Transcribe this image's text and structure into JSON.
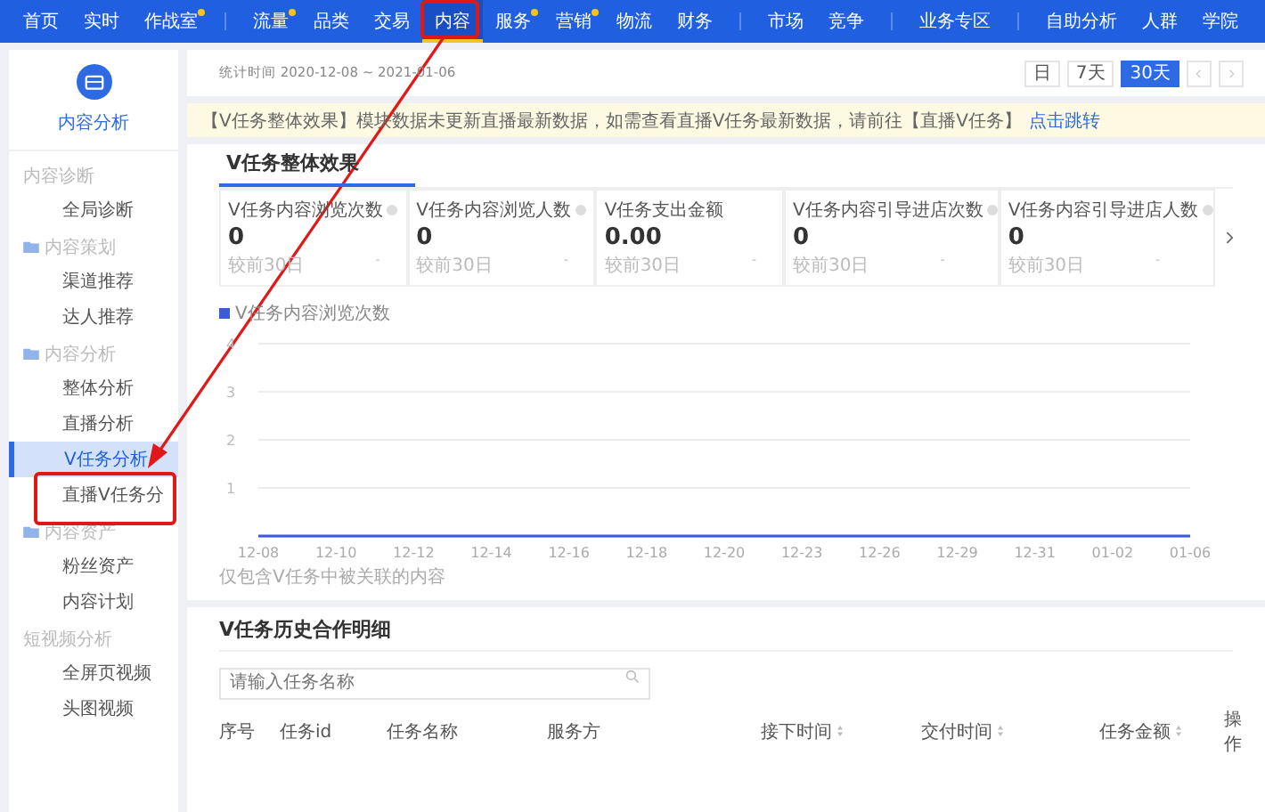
{
  "nav": {
    "groups": [
      {
        "items": [
          {
            "label": "首页",
            "selected": false,
            "dot": false
          },
          {
            "label": "实时",
            "selected": false,
            "dot": false
          },
          {
            "label": "作战室",
            "selected": false,
            "dot": true
          }
        ]
      },
      {
        "items": [
          {
            "label": "流量",
            "selected": false,
            "dot": true
          },
          {
            "label": "品类",
            "selected": false,
            "dot": false
          },
          {
            "label": "交易",
            "selected": false,
            "dot": false
          },
          {
            "label": "内容",
            "selected": true,
            "dot": false
          },
          {
            "label": "服务",
            "selected": false,
            "dot": true
          },
          {
            "label": "营销",
            "selected": false,
            "dot": true
          },
          {
            "label": "物流",
            "selected": false,
            "dot": false
          },
          {
            "label": "财务",
            "selected": false,
            "dot": false
          }
        ]
      },
      {
        "items": [
          {
            "label": "市场",
            "selected": false,
            "dot": false
          },
          {
            "label": "竞争",
            "selected": false,
            "dot": false
          }
        ]
      },
      {
        "items": [
          {
            "label": "业务专区",
            "selected": false,
            "dot": false
          }
        ]
      },
      {
        "items": [
          {
            "label": "自助分析",
            "selected": false,
            "dot": false
          },
          {
            "label": "人群",
            "selected": false,
            "dot": false
          },
          {
            "label": "学院",
            "selected": false,
            "dot": false
          }
        ]
      }
    ]
  },
  "sidebar": {
    "title": "内容分析",
    "items": [
      {
        "kind": "heading",
        "label": "内容诊断"
      },
      {
        "kind": "link",
        "label": "全局诊断",
        "selected": false
      },
      {
        "kind": "folder",
        "label": "内容策划"
      },
      {
        "kind": "link",
        "label": "渠道推荐",
        "selected": false
      },
      {
        "kind": "link",
        "label": "达人推荐",
        "selected": false
      },
      {
        "kind": "folder",
        "label": "内容分析"
      },
      {
        "kind": "link",
        "label": "整体分析",
        "selected": false
      },
      {
        "kind": "link",
        "label": "直播分析",
        "selected": false
      },
      {
        "kind": "link",
        "label": "V任务分析",
        "selected": true
      },
      {
        "kind": "link",
        "label": "直播V任务分",
        "selected": false
      },
      {
        "kind": "folder",
        "label": "内容资产"
      },
      {
        "kind": "link",
        "label": "粉丝资产",
        "selected": false
      },
      {
        "kind": "link",
        "label": "内容计划",
        "selected": false
      },
      {
        "kind": "heading",
        "label": "短视频分析"
      },
      {
        "kind": "link",
        "label": "全屏页视频",
        "selected": false
      },
      {
        "kind": "link",
        "label": "头图视频",
        "selected": false
      }
    ]
  },
  "date_bar": {
    "range": "统计时间 2020-12-08 ~ 2021-01-06",
    "periods": [
      {
        "label": "日",
        "selected": false
      },
      {
        "label": "7天",
        "selected": false
      },
      {
        "label": "30天",
        "selected": true
      }
    ]
  },
  "notice": {
    "text": "【V任务整体效果】模块数据未更新直播最新数据，如需查看直播V任务最新数据，请前往【直播V任务】",
    "link": "点击跳转"
  },
  "overview": {
    "tab": "V任务整体效果",
    "metrics": [
      {
        "label": "V任务内容浏览次数",
        "info": true,
        "value": "0",
        "compare": "较前30日",
        "change": "-"
      },
      {
        "label": "V任务内容浏览人数",
        "info": true,
        "value": "0",
        "compare": "较前30日",
        "change": "-"
      },
      {
        "label": "V任务支出金额",
        "info": false,
        "value": "0.00",
        "compare": "较前30日",
        "change": "-"
      },
      {
        "label": "V任务内容引导进店次数",
        "info": true,
        "value": "0",
        "compare": "较前30日",
        "change": "-"
      },
      {
        "label": "V任务内容引导进店人数",
        "info": true,
        "value": "0",
        "compare": "较前30日",
        "change": "-"
      }
    ],
    "chart_data": {
      "type": "line",
      "categories": [
        "12-08",
        "12-10",
        "12-12",
        "12-14",
        "12-16",
        "12-18",
        "12-20",
        "12-23",
        "12-26",
        "12-29",
        "12-31",
        "01-02",
        "01-06"
      ],
      "series": [
        {
          "name": "V任务内容浏览次数",
          "color": "#3b5bdb",
          "values": [
            0,
            0,
            0,
            0,
            0,
            0,
            0,
            0,
            0,
            0,
            0,
            0,
            0
          ]
        }
      ],
      "ylim": [
        0,
        4
      ],
      "yticks": [
        1,
        2,
        3,
        4
      ],
      "grid": true
    },
    "footnote": "仅包含V任务中被关联的内容"
  },
  "history": {
    "title": "V任务历史合作明细",
    "search": {
      "placeholder": "请输入任务名称"
    },
    "columns": [
      {
        "label": "序号",
        "sortable": false
      },
      {
        "label": "任务id",
        "sortable": false
      },
      {
        "label": "任务名称",
        "sortable": false
      },
      {
        "label": "服务方",
        "sortable": false
      },
      {
        "label": "接下时间",
        "sortable": true
      },
      {
        "label": "交付时间",
        "sortable": true
      },
      {
        "label": "任务金额",
        "sortable": true
      },
      {
        "label": "操作",
        "sortable": false
      }
    ]
  }
}
